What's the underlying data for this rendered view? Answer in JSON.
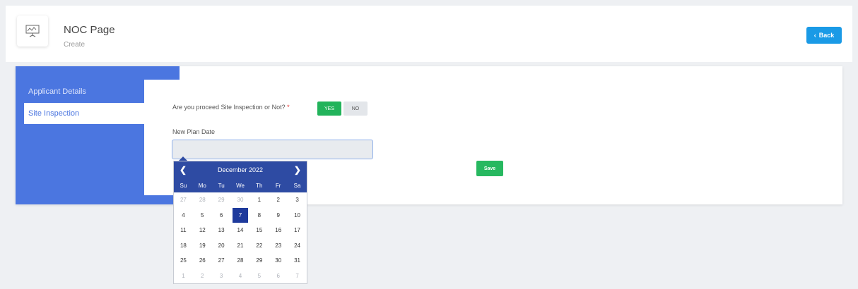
{
  "header": {
    "title": "NOC Page",
    "subtitle": "Create",
    "back_label": "Back",
    "icon": "presentation-board-icon"
  },
  "sidebar": {
    "items": [
      {
        "label": "Applicant Details",
        "active": false
      },
      {
        "label": "Site Inspection",
        "active": true
      }
    ]
  },
  "form": {
    "question": "Are you proceed Site Inspection or Not?",
    "required_mark": "*",
    "yes_label": "YES",
    "no_label": "NO",
    "selected": "YES",
    "date_label": "New Plan Date",
    "date_value": "",
    "save_label": "Save"
  },
  "datepicker": {
    "month_label": "December 2022",
    "prev_icon": "chevron-left-icon",
    "next_icon": "chevron-right-icon",
    "weekdays": [
      "Su",
      "Mo",
      "Tu",
      "We",
      "Th",
      "Fr",
      "Sa"
    ],
    "selected_day": "7",
    "weeks": [
      [
        {
          "d": "27",
          "muted": true
        },
        {
          "d": "28",
          "muted": true
        },
        {
          "d": "29",
          "muted": true
        },
        {
          "d": "30",
          "muted": true
        },
        {
          "d": "1"
        },
        {
          "d": "2"
        },
        {
          "d": "3"
        }
      ],
      [
        {
          "d": "4"
        },
        {
          "d": "5"
        },
        {
          "d": "6"
        },
        {
          "d": "7"
        },
        {
          "d": "8"
        },
        {
          "d": "9"
        },
        {
          "d": "10"
        }
      ],
      [
        {
          "d": "11"
        },
        {
          "d": "12"
        },
        {
          "d": "13"
        },
        {
          "d": "14"
        },
        {
          "d": "15"
        },
        {
          "d": "16"
        },
        {
          "d": "17"
        }
      ],
      [
        {
          "d": "18"
        },
        {
          "d": "19"
        },
        {
          "d": "20"
        },
        {
          "d": "21"
        },
        {
          "d": "22"
        },
        {
          "d": "23"
        },
        {
          "d": "24"
        }
      ],
      [
        {
          "d": "25"
        },
        {
          "d": "26"
        },
        {
          "d": "27"
        },
        {
          "d": "28"
        },
        {
          "d": "29"
        },
        {
          "d": "30"
        },
        {
          "d": "31"
        }
      ],
      [
        {
          "d": "1",
          "muted": true
        },
        {
          "d": "2",
          "muted": true
        },
        {
          "d": "3",
          "muted": true
        },
        {
          "d": "4",
          "muted": true
        },
        {
          "d": "5",
          "muted": true
        },
        {
          "d": "6",
          "muted": true
        },
        {
          "d": "7",
          "muted": true
        }
      ]
    ]
  },
  "colors": {
    "sidebar": "#4b76e0",
    "accent_blue": "#1a9ae6",
    "success_green": "#22b35b",
    "datepicker_header": "#2e4ba3",
    "selected_day": "#1e3a9c"
  }
}
